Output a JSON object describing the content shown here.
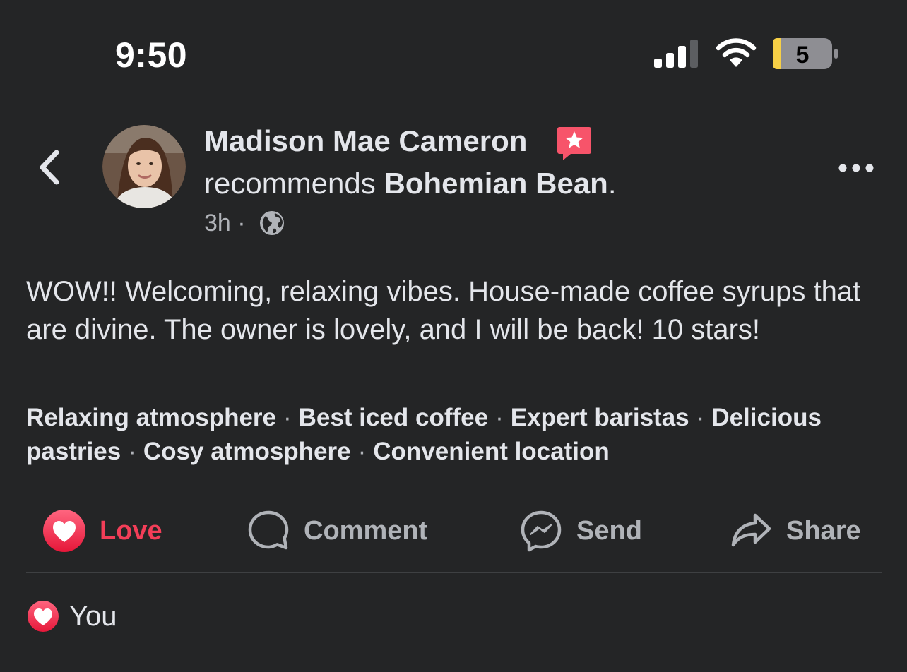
{
  "status_bar": {
    "time": "9:50",
    "battery_level": "5",
    "signal_icon": "cellular-signal-icon",
    "wifi_icon": "wifi-icon",
    "battery_icon": "battery-icon"
  },
  "header": {
    "back_icon": "chevron-left-icon",
    "author_name": "Madison Mae Cameron",
    "recommends_icon": "recommendation-star-icon",
    "recommends_text": "recommends",
    "place_name": "Bohemian Bean",
    "period": ".",
    "time_ago": "3h",
    "separator": "·",
    "privacy_icon": "globe-icon",
    "more_icon": "more-horizontal-icon"
  },
  "post": {
    "text": "WOW!! Welcoming, relaxing vibes. House-made coffee syrups that are divine. The owner is lovely, and I will be back! 10 stars!",
    "tags": [
      "Relaxing atmosphere",
      "Best iced coffee",
      "Expert baristas",
      "Delicious pastries",
      "Cosy atmosphere",
      "Convenient location"
    ],
    "tag_separator": "·"
  },
  "actions": {
    "love": {
      "label": "Love",
      "icon": "love-reaction-icon"
    },
    "comment": {
      "label": "Comment",
      "icon": "comment-bubble-icon"
    },
    "send": {
      "label": "Send",
      "icon": "messenger-icon"
    },
    "share": {
      "label": "Share",
      "icon": "share-arrow-icon"
    }
  },
  "reactions": {
    "icon": "love-reaction-icon",
    "label": "You"
  },
  "colors": {
    "background": "#242526",
    "text_primary": "#e4e6eb",
    "text_secondary": "#b0b3b8",
    "love_red": "#f33e58",
    "recommend_badge": "#f7546a",
    "battery_low": "#f7d046"
  }
}
